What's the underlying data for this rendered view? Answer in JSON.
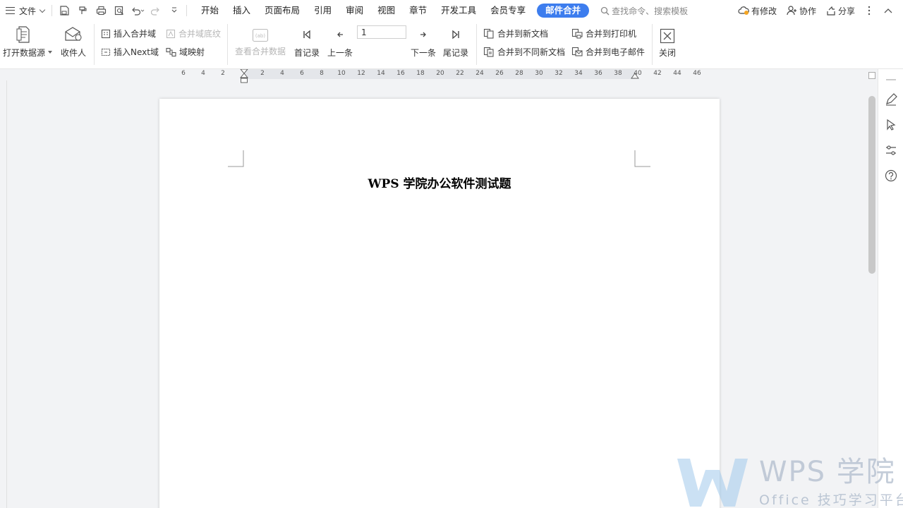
{
  "menubar": {
    "file_label": "文件",
    "tabs": [
      "开始",
      "插入",
      "页面布局",
      "引用",
      "审阅",
      "视图",
      "章节",
      "开发工具",
      "会员专享",
      "邮件合并"
    ],
    "active_tab": "邮件合并",
    "search_placeholder": "查找命令、搜索模板",
    "modified_label": "有修改",
    "collab_label": "协作",
    "share_label": "分享"
  },
  "ribbon": {
    "open_datasource": "打开数据源",
    "recipients": "收件人",
    "insert_merge_field": "插入合并域",
    "merge_field_shading": "合并域底纹",
    "insert_next_field": "插入Next域",
    "field_mapping": "域映射",
    "view_merged_data": "查看合并数据",
    "first_record": "首记录",
    "prev_record": "上一条",
    "record_number": "1",
    "next_record": "下一条",
    "last_record": "尾记录",
    "merge_to_new_doc": "合并到新文档",
    "merge_to_diff_docs": "合并到不同新文档",
    "merge_to_printer": "合并到打印机",
    "merge_to_email": "合并到电子邮件",
    "close": "关闭"
  },
  "ruler": {
    "left_ticks": [
      "6",
      "4",
      "2"
    ],
    "right_ticks": [
      "2",
      "4",
      "6",
      "8",
      "10",
      "12",
      "14",
      "16",
      "18",
      "20",
      "22",
      "24",
      "26",
      "28",
      "30",
      "32",
      "34",
      "36",
      "38",
      "40",
      "42",
      "44",
      "46"
    ]
  },
  "document": {
    "title": "WPS 学院办公软件测试题"
  },
  "watermark": {
    "brand": "WPS 学院",
    "subtitle": "Office 技巧学习平台"
  },
  "colors": {
    "accent": "#3d7dee",
    "watermark": "#b0bccc"
  }
}
